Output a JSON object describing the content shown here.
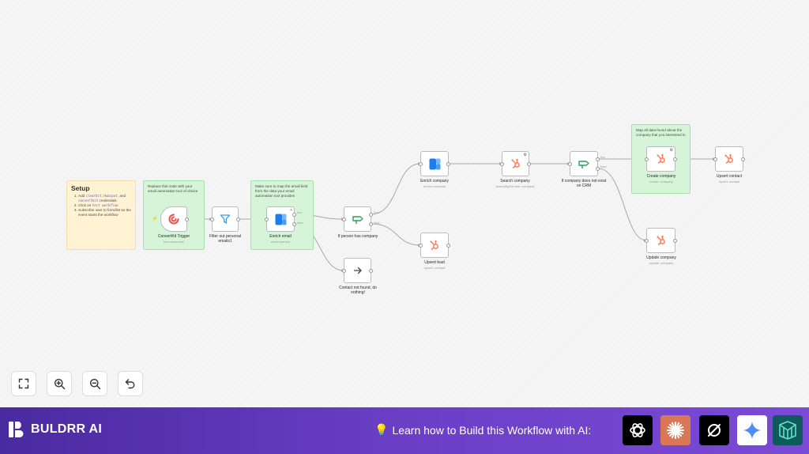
{
  "setup_note": {
    "title": "Setup",
    "items": [
      {
        "pre": "Add ",
        "codes": [
          "clearbit",
          "Hubspot"
        ],
        "mid": ", and ",
        "code3": "convertkit",
        "post": " credentials"
      },
      {
        "pre": "Click on ",
        "code": "test workflow",
        "post": ""
      },
      {
        "pre": "Subscribe user to form/list so the event starts the workflow",
        "code": "",
        "post": ""
      }
    ]
  },
  "green_notes": {
    "replace": "Replace this node with your email automation tool of choice",
    "mapping": "Make sure to map the email field from the data your email automation tool provides",
    "map_all": "Map all data found about the company that you interested in"
  },
  "nodes": {
    "convertkit_trigger": {
      "label": "ConvertKit Trigger",
      "subtitle": "form:subscribe"
    },
    "filter": {
      "label": "Filter out personal emails1"
    },
    "enrich_email": {
      "label": "Enrich email",
      "subtitle": "enrich:person"
    },
    "if_person": {
      "label": "If person has company"
    },
    "contact_not_found": {
      "label": "Contact not found, do nothing!"
    },
    "enrich_company": {
      "label": "Enrich company",
      "subtitle": "enrich:company"
    },
    "upsert_lead": {
      "label": "Upsert lead",
      "subtitle": "upsert: contact"
    },
    "search_company": {
      "label": "Search company",
      "subtitle": "searchByDomain: company"
    },
    "if_company": {
      "label": "If company does not exist on CRM"
    },
    "create_company": {
      "label": "Create company",
      "subtitle": "create: company"
    },
    "update_company": {
      "label": "Update company",
      "subtitle": "update: company"
    },
    "upsert_contact": {
      "label": "Upsert contact",
      "subtitle": "upsert: contact"
    }
  },
  "branch_labels": {
    "true": "true",
    "false": "false"
  },
  "controls": {
    "fit": "fit-view",
    "zoom_in": "zoom-in",
    "zoom_out": "zoom-out",
    "reset": "reset-zoom"
  },
  "footer": {
    "brand": "BULDRR AI",
    "bulb": "💡",
    "cta": "Learn how to Build this Workflow with AI:",
    "ai_tools": [
      "ChatGPT",
      "Claude",
      "Perplexity",
      "Gemini",
      "Manus"
    ]
  },
  "colors": {
    "accent": "#6a3fc6",
    "hubspot": "#ff7a59",
    "clearbit": "#1a7df0",
    "if_node": "#2e9e5b",
    "convertkit": "#ef4f4f",
    "filter": "#3a9bdc"
  }
}
